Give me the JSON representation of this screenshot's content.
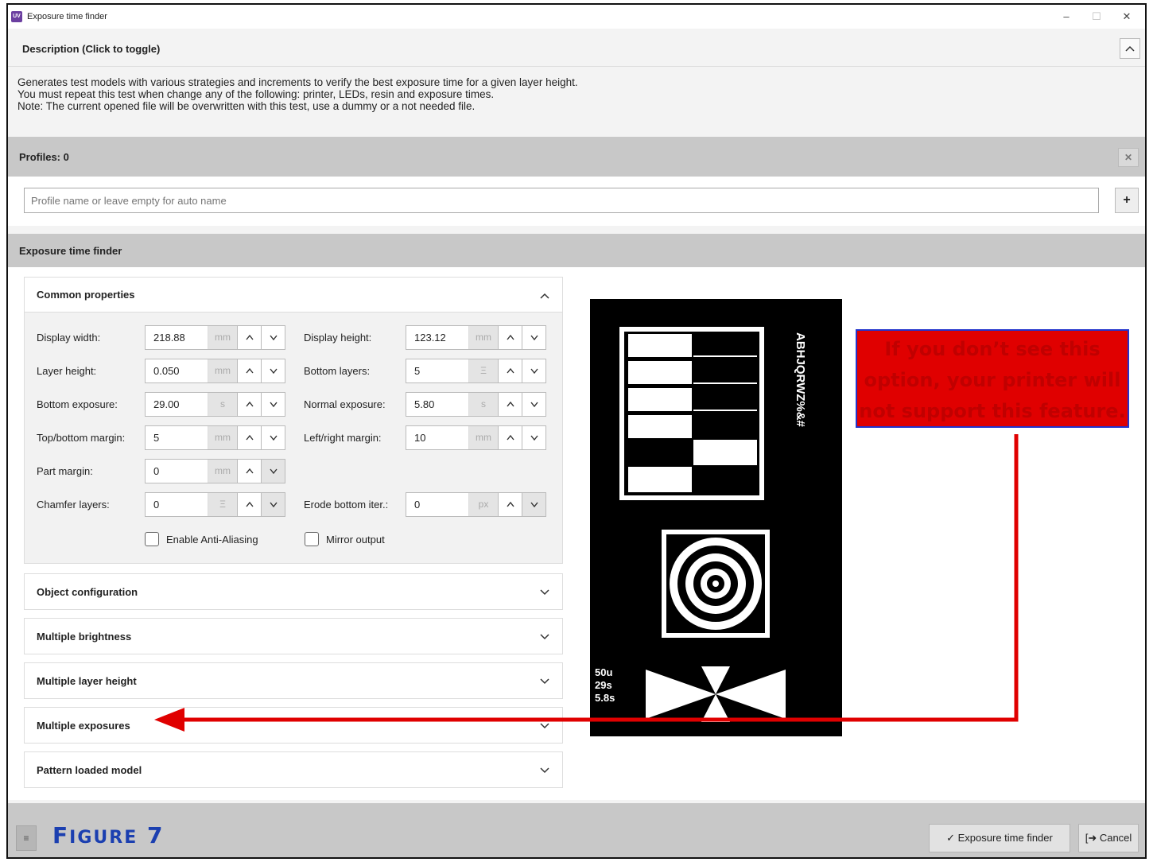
{
  "window": {
    "title": "Exposure time finder",
    "minimize": "–",
    "maximize": "☐",
    "close": "✕"
  },
  "description": {
    "header": "Description (Click to toggle)",
    "toggle": "^",
    "lines": [
      "Generates test models with various strategies and increments to verify the best exposure time for a given layer height.",
      "You must repeat this test when change any of the following: printer, LEDs, resin and exposure times.",
      "Note: The current opened file will be overwritten with this test, use a dummy or a not needed file."
    ]
  },
  "profiles": {
    "header": "Profiles: 0",
    "clear": "✕",
    "placeholder": "Profile name or leave empty for auto name",
    "add": "+"
  },
  "main": {
    "header": "Exposure time finder",
    "common": {
      "title": "Common properties",
      "chevron": "^",
      "display_width": {
        "label": "Display width:",
        "value": "218.88",
        "unit": "mm"
      },
      "display_height": {
        "label": "Display height:",
        "value": "123.12",
        "unit": "mm"
      },
      "layer_height": {
        "label": "Layer height:",
        "value": "0.050",
        "unit": "mm"
      },
      "bottom_layers": {
        "label": "Bottom layers:",
        "value": "5",
        "unit": "Ξ"
      },
      "bottom_exposure": {
        "label": "Bottom exposure:",
        "value": "29.00",
        "unit": "s"
      },
      "normal_exposure": {
        "label": "Normal exposure:",
        "value": "5.80",
        "unit": "s"
      },
      "top_bottom_margin": {
        "label": "Top/bottom margin:",
        "value": "5",
        "unit": "mm"
      },
      "left_right_margin": {
        "label": "Left/right margin:",
        "value": "10",
        "unit": "mm"
      },
      "part_margin": {
        "label": "Part margin:",
        "value": "0",
        "unit": "mm"
      },
      "chamfer_layers": {
        "label": "Chamfer layers:",
        "value": "0",
        "unit": "Ξ"
      },
      "erode_bottom": {
        "label": "Erode bottom iter.:",
        "value": "0",
        "unit": "px"
      },
      "anti_aliasing": "Enable Anti-Aliasing",
      "mirror": "Mirror output",
      "up": "⌃",
      "down": "⌄"
    },
    "sections": {
      "object_configuration": "Object configuration",
      "multiple_brightness": "Multiple brightness",
      "multiple_layer_height": "Multiple layer height",
      "multiple_exposures": "Multiple exposures",
      "pattern_loaded_model": "Pattern loaded model",
      "chevron": "⌄"
    },
    "preview": {
      "text_vertical": "ABHJQRWZ%&#",
      "line1": "50u",
      "line2": "29s",
      "line3": "5.8s"
    }
  },
  "annotation": {
    "note": "If you don’t see this option, your printer will not support this feature.",
    "figure_label_first": "F",
    "figure_label_rest": "IGURE",
    "figure_number": "7"
  },
  "footer": {
    "menu": "≡",
    "primary_label": "✓  Exposure time finder",
    "cancel_label": "[➜  Cancel"
  },
  "colors": {
    "arrow": "#e00000",
    "figure_blue": "#1b3fb0"
  }
}
